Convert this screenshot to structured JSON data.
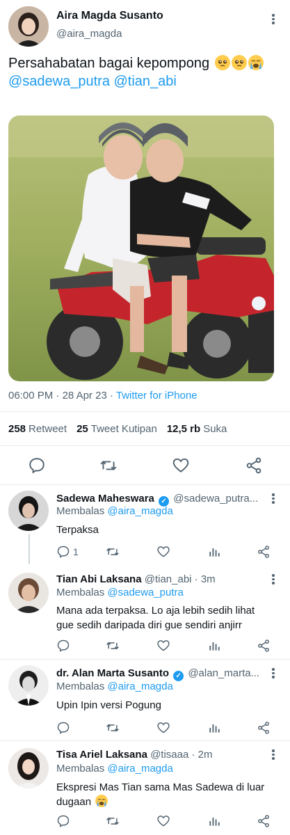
{
  "tweet": {
    "author_name": "Aira Magda Susanto",
    "author_handle": "@aira_magda",
    "text": "Persahabatan bagai kepompong",
    "mentions": "@sadewa_putra @tian_abi",
    "time": "06:00 PM",
    "date": "28 Apr 23",
    "source": "Twitter for iPhone",
    "stats": {
      "retweets_count": "258",
      "retweets_label": "Retweet",
      "quotes_count": "25",
      "quotes_label": "Tweet Kutipan",
      "likes_count": "12,5 rb",
      "likes_label": "Suka"
    }
  },
  "replies": [
    {
      "name": "Sadewa Maheswara",
      "verified": true,
      "handle": "@sadewa_putra...",
      "replying_prefix": "Membalas",
      "replying_to": "@aira_magda",
      "text": "Terpaksa",
      "reply_count": "1"
    },
    {
      "name": "Tian Abi Laksana",
      "verified": false,
      "handle": "@tian_abi · 3m",
      "replying_prefix": "Membalas",
      "replying_to": "@sadewa_putra",
      "text": "Mana ada terpaksa. Lo aja lebih sedih lihat gue sedih daripada diri gue sendiri anjirr",
      "reply_count": ""
    },
    {
      "name": "dr. Alan Marta Susanto",
      "verified": true,
      "handle": "@alan_marta...",
      "replying_prefix": "Membalas",
      "replying_to": "@aira_magda",
      "text": "Upin Ipin versi Pogung",
      "reply_count": ""
    },
    {
      "name": "Tisa Ariel Laksana",
      "verified": false,
      "handle": "@tisaaa · 2m",
      "replying_prefix": "Membalas",
      "replying_to": "@aira_magda",
      "text": "Ekspresi Mas Tian sama Mas Sadewa di luar dugaan",
      "reply_count": ""
    }
  ],
  "colors": {
    "accent": "#1d9bf0",
    "secondary_text": "#536471",
    "divider": "#e6ecf0"
  },
  "icons": [
    "more-icon",
    "reply-icon",
    "retweet-icon",
    "like-icon",
    "share-icon",
    "views-icon",
    "verified-icon",
    "pleading-face-emoji",
    "crying-face-emoji"
  ]
}
